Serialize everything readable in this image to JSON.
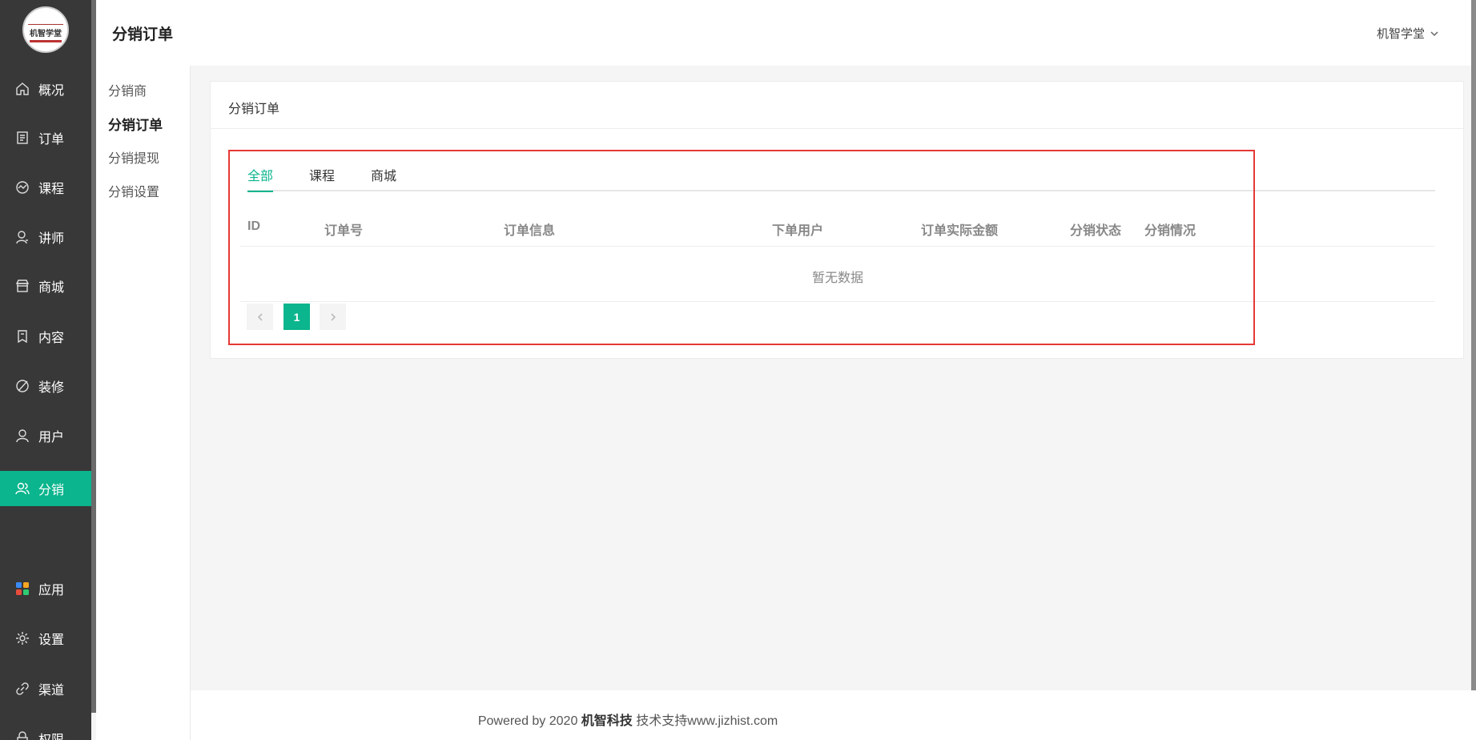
{
  "brand": {
    "logo_text": "机智学堂"
  },
  "sidebar": {
    "items": [
      {
        "label": "概况",
        "icon": "home-icon"
      },
      {
        "label": "订单",
        "icon": "order-icon"
      },
      {
        "label": "课程",
        "icon": "course-icon"
      },
      {
        "label": "讲师",
        "icon": "teacher-icon"
      },
      {
        "label": "商城",
        "icon": "store-icon"
      },
      {
        "label": "内容",
        "icon": "content-icon"
      },
      {
        "label": "装修",
        "icon": "decorate-icon"
      },
      {
        "label": "用户",
        "icon": "user-icon"
      },
      {
        "label": "分销",
        "icon": "distribution-icon",
        "active": true
      },
      {
        "label": "应用",
        "icon": "apps-icon"
      },
      {
        "label": "设置",
        "icon": "gear-icon"
      },
      {
        "label": "渠道",
        "icon": "link-icon"
      },
      {
        "label": "权限",
        "icon": "lock-icon"
      }
    ]
  },
  "header": {
    "title": "分销订单",
    "user": "机智学堂"
  },
  "subnav": {
    "items": [
      {
        "label": "分销商"
      },
      {
        "label": "分销订单",
        "active": true
      },
      {
        "label": "分销提现"
      },
      {
        "label": "分销设置"
      }
    ]
  },
  "card": {
    "title": "分销订单"
  },
  "tabs": [
    {
      "label": "全部",
      "active": true
    },
    {
      "label": "课程"
    },
    {
      "label": "商城"
    }
  ],
  "table": {
    "columns": [
      "ID",
      "订单号",
      "订单信息",
      "下单用户",
      "订单实际金额",
      "分销状态",
      "分销情况"
    ],
    "empty_text": "暂无数据"
  },
  "pagination": {
    "current": "1"
  },
  "footer": {
    "prefix": "Powered by 2020 ",
    "company": "机智科技",
    "suffix": " 技术支持www.jizhist.com"
  },
  "colors": {
    "accent": "#0bb58d",
    "sidebar": "#383838",
    "highlight": "#e53935"
  }
}
